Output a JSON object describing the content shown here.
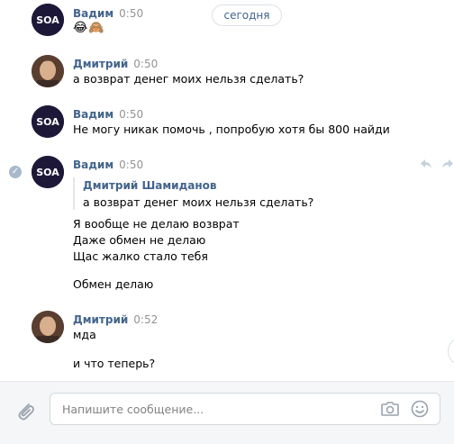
{
  "date_separator": "сегодня",
  "messages": [
    {
      "author": "Вадим",
      "time": "0:50",
      "lines": [
        "😂🙈"
      ],
      "avatar": "soa-logo"
    },
    {
      "author": "Дмитрий",
      "time": "0:50",
      "lines": [
        "а возврат денег моих нельзя сделать?"
      ],
      "avatar": "user-photo"
    },
    {
      "author": "Вадим",
      "time": "0:50",
      "lines": [
        "Не могу никак помочь , попробую хотя бы 800 найди"
      ],
      "avatar": "soa-logo"
    },
    {
      "author": "Вадим",
      "time": "0:50",
      "avatar": "soa-logo",
      "quote": {
        "author": "Дмитрий Шамиданов",
        "text": "а возврат денег моих нельзя сделать?"
      },
      "lines": [
        "Я вообще не делаю возврат",
        "Даже обмен не делаю",
        "Щас жалко стало тебя",
        "Обмен делаю"
      ]
    },
    {
      "author": "Дмитрий",
      "time": "0:52",
      "lines": [
        "мда",
        "и что теперь?"
      ],
      "avatar": "user-photo"
    }
  ],
  "avatar_logo_text": "SOA",
  "composer": {
    "placeholder": "Напишите сообщение..."
  },
  "icons": [
    "check-circle-icon",
    "reply-icon",
    "forward-icon",
    "attach-icon",
    "camera-icon",
    "smile-icon",
    "chevron-down-icon"
  ],
  "colors": {
    "author": "#42648b",
    "time": "#939393",
    "background": "#ffffff",
    "composer_bg": "#f5f6f8"
  }
}
